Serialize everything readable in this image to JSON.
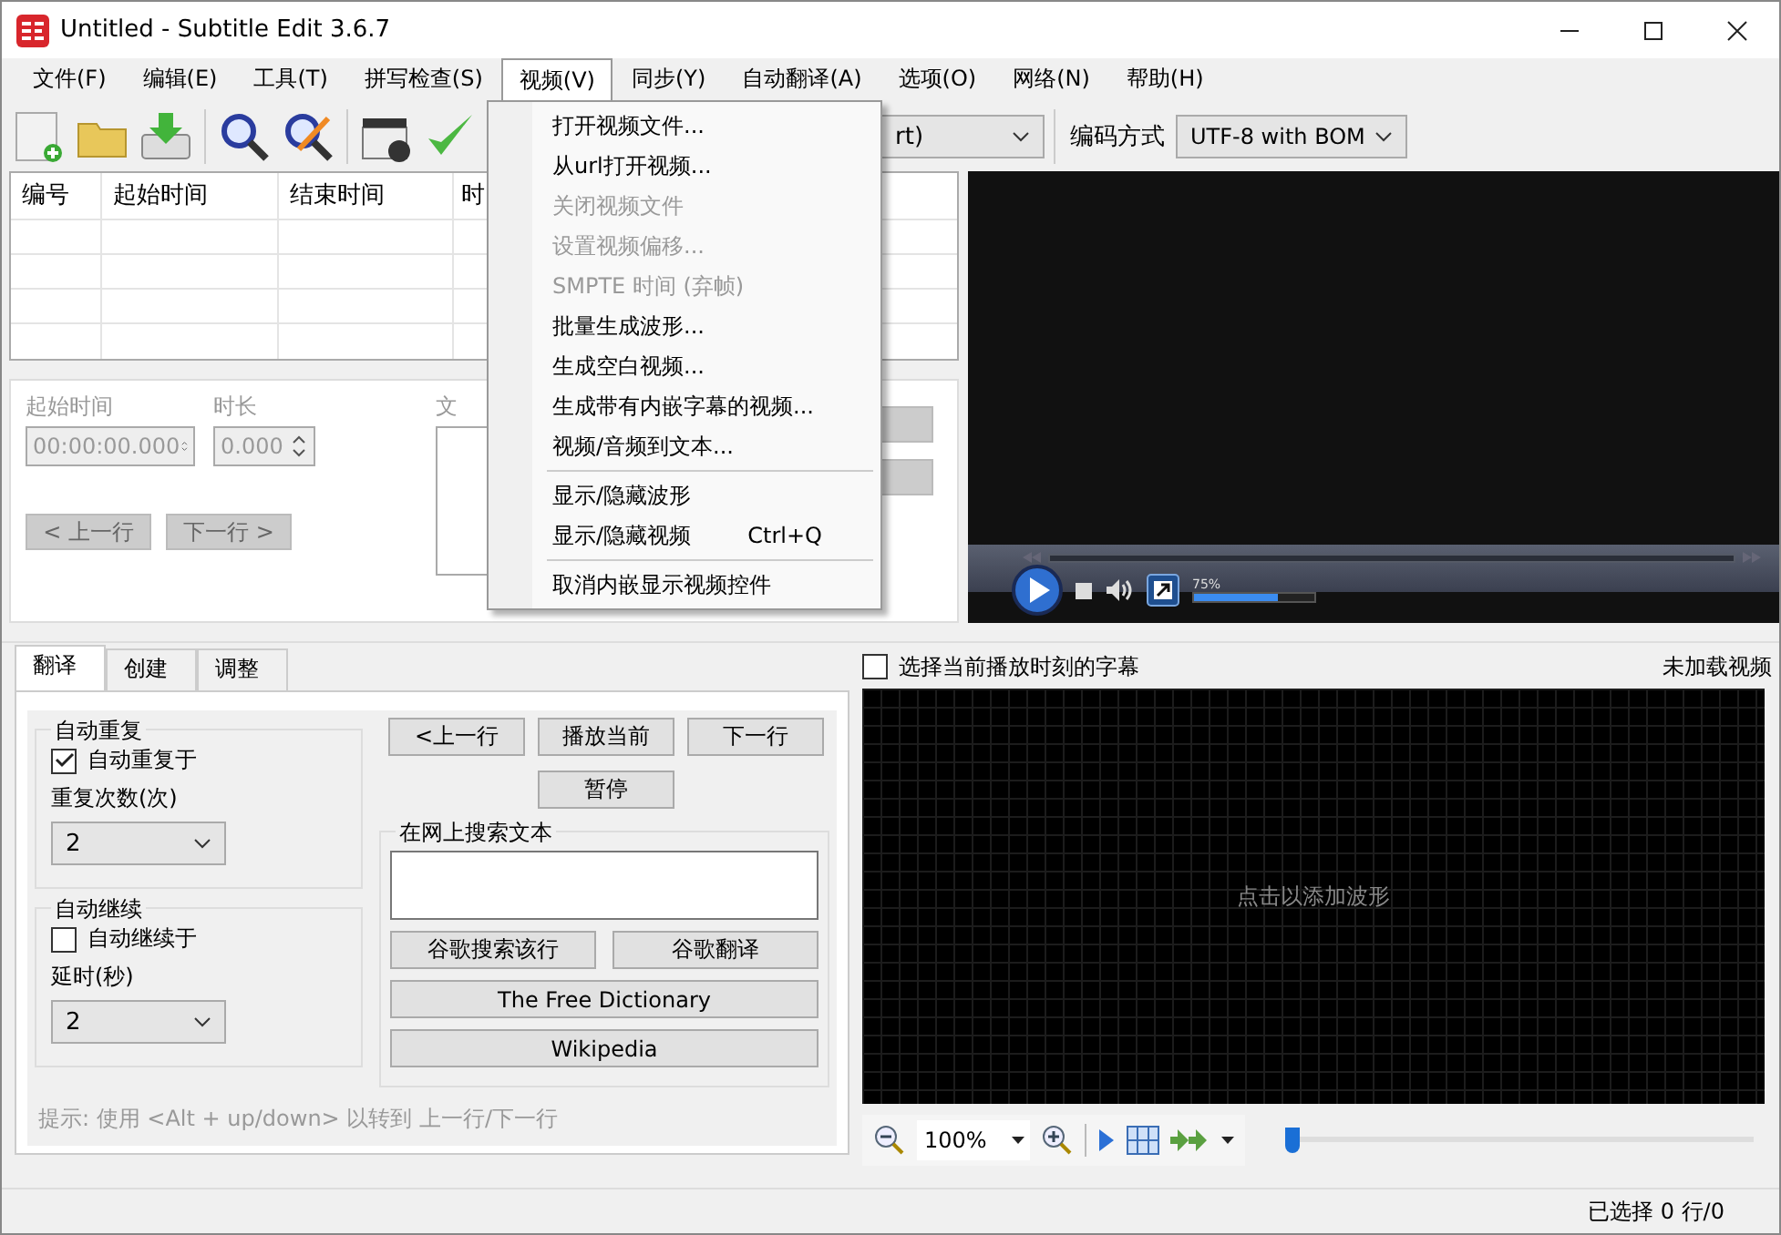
{
  "window": {
    "title": "Untitled - Subtitle Edit 3.6.7"
  },
  "menu_bar": [
    {
      "label": "文件(F)",
      "selected": false
    },
    {
      "label": "编辑(E)",
      "selected": false
    },
    {
      "label": "工具(T)",
      "selected": false
    },
    {
      "label": "拼写检查(S)",
      "selected": false
    },
    {
      "label": "视频(V)",
      "selected": true
    },
    {
      "label": "同步(Y)",
      "selected": false
    },
    {
      "label": "自动翻译(A)",
      "selected": false
    },
    {
      "label": "选项(O)",
      "selected": false
    },
    {
      "label": "网络(N)",
      "selected": false
    },
    {
      "label": "帮助(H)",
      "selected": false
    }
  ],
  "video_menu": {
    "items": [
      {
        "kind": "item",
        "label": "打开视频文件...",
        "disabled": false
      },
      {
        "kind": "item",
        "label": "从url打开视频...",
        "disabled": false
      },
      {
        "kind": "item",
        "label": "关闭视频文件",
        "disabled": true
      },
      {
        "kind": "item",
        "label": "设置视频偏移...",
        "disabled": true
      },
      {
        "kind": "item",
        "label": "SMPTE 时间 (弃帧)",
        "disabled": true
      },
      {
        "kind": "item",
        "label": "批量生成波形...",
        "disabled": false
      },
      {
        "kind": "item",
        "label": "生成空白视频...",
        "disabled": false
      },
      {
        "kind": "item",
        "label": "生成带有内嵌字幕的视频...",
        "disabled": false
      },
      {
        "kind": "item",
        "label": "视频/音频到文本...",
        "disabled": false
      },
      {
        "kind": "separator"
      },
      {
        "kind": "item",
        "label": "显示/隐藏波形",
        "disabled": false
      },
      {
        "kind": "item",
        "label": "显示/隐藏视频",
        "shortcut": "Ctrl+Q",
        "disabled": false
      },
      {
        "kind": "separator"
      },
      {
        "kind": "item",
        "label": "取消内嵌显示视频控件",
        "disabled": false
      }
    ]
  },
  "toolbar": {
    "format_combo": {
      "value": "rt)"
    },
    "encoding_label": "编码方式",
    "encoding_combo": {
      "value": "UTF-8 with BOM"
    }
  },
  "subtitle_table": {
    "columns": [
      "编号",
      "起始时间",
      "结束时间",
      "时"
    ]
  },
  "editor": {
    "disabled": true,
    "start_label": "起始时间",
    "start_value": "00:00:00.000",
    "duration_label": "时长",
    "duration_value": "0.000",
    "text_label": "文",
    "prev_button": "< 上一行",
    "next_button": "下一行 >"
  },
  "video_player": {
    "volume": {
      "level": 0.7,
      "reading": "75%"
    }
  },
  "tabs": [
    {
      "label": "翻译",
      "selected": true
    },
    {
      "label": "创建",
      "selected": false
    },
    {
      "label": "调整",
      "selected": false
    }
  ],
  "auto_repeat": {
    "title": "自动重复",
    "checkbox": {
      "label": "自动重复于",
      "checked": true
    },
    "count_label": "重复次数(次)",
    "count_value": "2"
  },
  "auto_continue": {
    "title": "自动继续",
    "checkbox": {
      "label": "自动继续于",
      "checked": false
    },
    "delay_label": "延时(秒)",
    "delay_value": "2"
  },
  "playback_buttons": [
    "<上一行",
    "播放当前",
    "下一行",
    "暂停"
  ],
  "web_search": {
    "title": "在网上搜索文本",
    "buttons": [
      "谷歌搜索该行",
      "谷歌翻译",
      "The Free Dictionary",
      "Wikipedia"
    ]
  },
  "hint": "提示: 使用 <Alt + up/down> 以转到 上一行/下一行",
  "waveform": {
    "select_checkbox": {
      "label": "选择当前播放时刻的字幕",
      "checked": false
    },
    "status": "未加载视频",
    "placeholder": "点击以添加波形",
    "zoom": "100%",
    "position": {
      "level": 0
    }
  },
  "status_bar": {
    "selection": "已选择 0 行/0"
  }
}
